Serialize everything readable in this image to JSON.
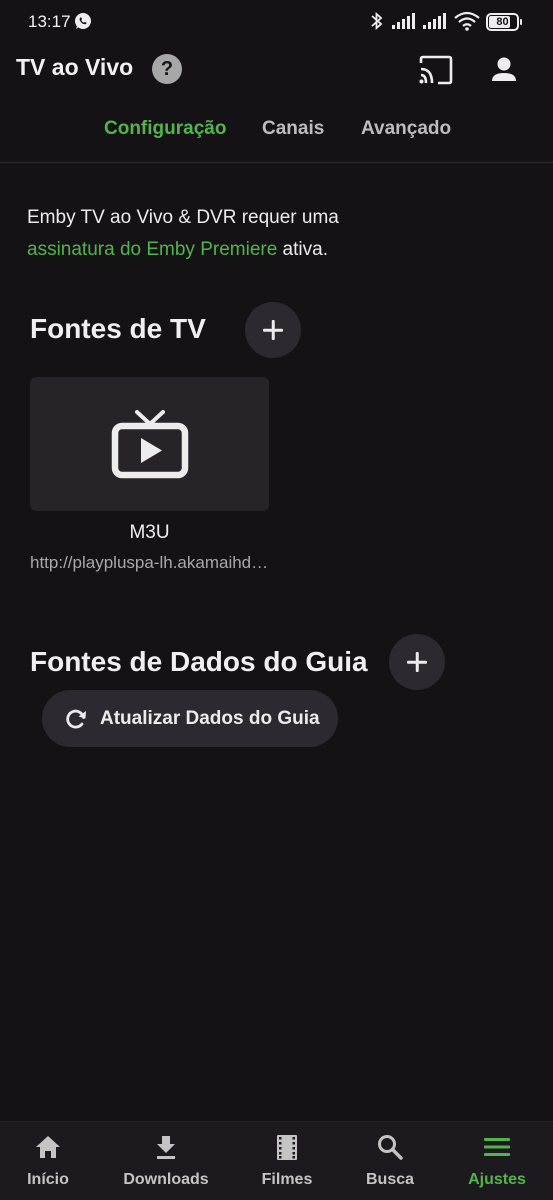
{
  "status_bar": {
    "time": "13:17",
    "battery": "80"
  },
  "header": {
    "title": "TV ao Vivo",
    "help_symbol": "?"
  },
  "tabs": [
    {
      "label": "Configuração",
      "active": true
    },
    {
      "label": "Canais",
      "active": false
    },
    {
      "label": "Avançado",
      "active": false
    }
  ],
  "notice": {
    "line1": "Emby TV ao Vivo & DVR requer uma",
    "link": "assinatura do Emby Premiere",
    "suffix": " ativa."
  },
  "tv_sources": {
    "title": "Fontes de TV",
    "items": [
      {
        "name": "M3U",
        "url": "http://playpluspa-lh.akamaihd.net/",
        "icon": "live-tv-icon"
      }
    ]
  },
  "guide_sources": {
    "title": "Fontes de Dados do Guia",
    "refresh_label": "Atualizar Dados do Guia"
  },
  "bottom_nav": [
    {
      "label": "Início",
      "icon": "home-icon",
      "active": false
    },
    {
      "label": "Downloads",
      "icon": "download-icon",
      "active": false
    },
    {
      "label": "Filmes",
      "icon": "film-icon",
      "active": false
    },
    {
      "label": "Busca",
      "icon": "search-icon",
      "active": false
    },
    {
      "label": "Ajustes",
      "icon": "menu-icon",
      "active": true
    }
  ],
  "colors": {
    "accent": "#52b54b",
    "background": "#141215",
    "surface": "#2c2a30"
  }
}
